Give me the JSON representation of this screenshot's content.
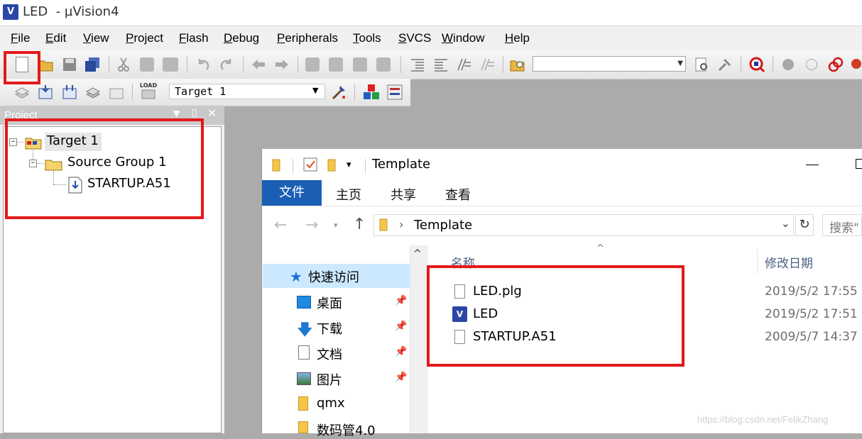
{
  "app": {
    "icon_text": "V",
    "title": "LED  - µVision4"
  },
  "menu": [
    "File",
    "Edit",
    "View",
    "Project",
    "Flash",
    "Debug",
    "Peripherals",
    "Tools",
    "SVCS",
    "Window",
    "Help"
  ],
  "toolbar2": {
    "target_select": "Target 1",
    "load_label": "LOAD"
  },
  "project_pane": {
    "title": "Project",
    "tree": {
      "target": "Target 1",
      "group": "Source Group 1",
      "file": "STARTUP.A51"
    }
  },
  "explorer": {
    "title": "Template",
    "ribbon": {
      "file": "文件",
      "tabs": [
        "主页",
        "共享",
        "查看"
      ]
    },
    "address": {
      "path": "Template",
      "search_placeholder": "搜索\""
    },
    "nav": {
      "quick_access": "快速访问",
      "items": [
        "桌面",
        "下载",
        "文档",
        "图片",
        "qmx",
        "数码管4.0"
      ]
    },
    "columns": {
      "name": "名称",
      "date": "修改日期"
    },
    "files": [
      {
        "name": "LED.plg",
        "date": "2019/5/2 17:55"
      },
      {
        "name": "LED",
        "date": "2019/5/2 17:51"
      },
      {
        "name": "STARTUP.A51",
        "date": "2009/5/7 14:37"
      }
    ]
  },
  "colors": {
    "highlight_red": "#e3191b",
    "ribbon_blue": "#1a5fb4",
    "quick_access_bg": "#cce8ff"
  },
  "watermark": "https://blog.csdn.net/FelikZhang"
}
